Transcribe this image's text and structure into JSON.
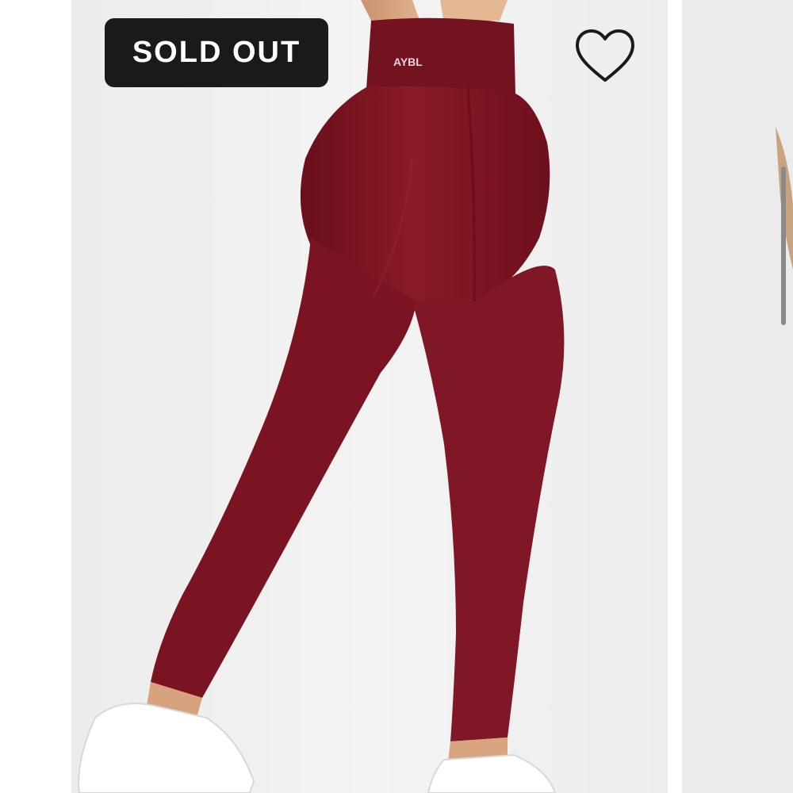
{
  "product": {
    "status_badge": "SOLD OUT",
    "wishlist_icon": "heart-outline-icon",
    "waistband_logo": "AYBL"
  },
  "colors": {
    "badge_bg": "#1a1a1a",
    "badge_text": "#ffffff",
    "leggings": "#7d1623",
    "background": "#f0f0f0"
  }
}
